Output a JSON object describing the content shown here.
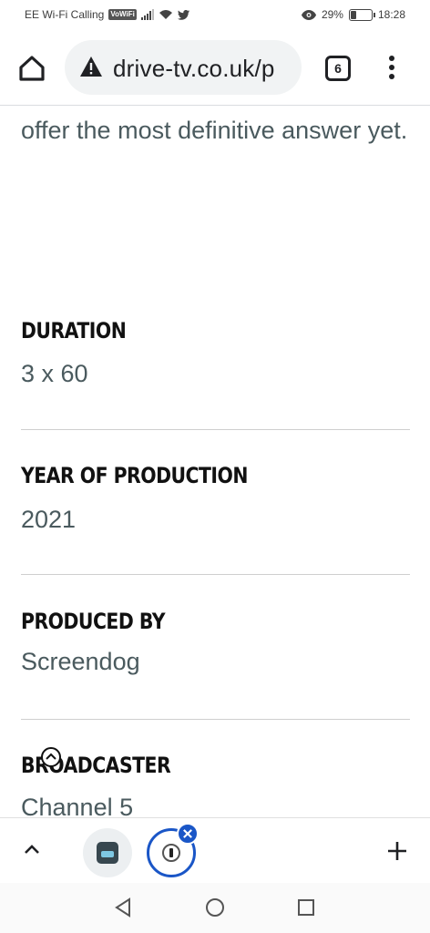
{
  "status_bar": {
    "carrier": "EE Wi-Fi Calling",
    "volte_badge": "VoWiFi",
    "battery_percent": "29%",
    "battery_level": 0.29,
    "time": "18:28"
  },
  "browser": {
    "url": "drive-tv.co.uk/p",
    "tab_count": "6"
  },
  "article": {
    "intro_text": "offer the most definitive answer yet.",
    "details": [
      {
        "label": "DURATION",
        "value": "3 x 60"
      },
      {
        "label": "YEAR OF PRODUCTION",
        "value": "2021"
      },
      {
        "label": "PRODUCED BY",
        "value": "Screendog"
      },
      {
        "label": "BROADCASTER",
        "value": "Channel 5"
      }
    ]
  },
  "colors": {
    "accent": "#1a56c7",
    "body_text": "#4a5a5e",
    "heading_text": "#111111"
  }
}
